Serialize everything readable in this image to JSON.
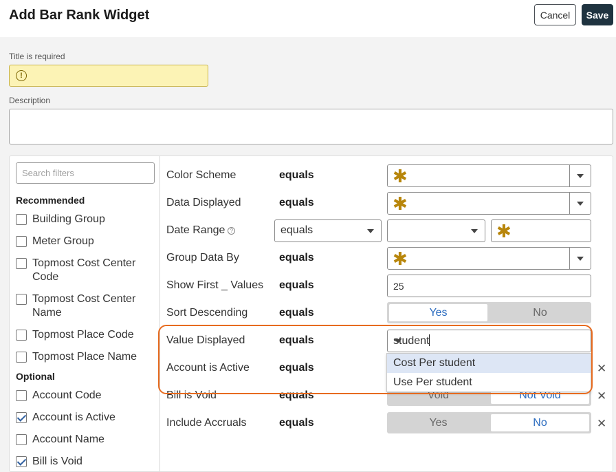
{
  "header": {
    "title": "Add Bar Rank Widget",
    "cancel_label": "Cancel",
    "save_label": "Save"
  },
  "form": {
    "title_label": "Title is required",
    "title_value": "",
    "title_warning_icon": "warning-circle-icon",
    "description_label": "Description",
    "description_value": ""
  },
  "filters": {
    "search_placeholder": "Search filters",
    "recommended_heading": "Recommended",
    "recommended": [
      {
        "label": "Building Group",
        "checked": false
      },
      {
        "label": "Meter Group",
        "checked": false
      },
      {
        "label": "Topmost Cost Center Code",
        "checked": false
      },
      {
        "label": "Topmost Cost Center Name",
        "checked": false
      },
      {
        "label": "Topmost Place Code",
        "checked": false
      },
      {
        "label": "Topmost Place Name",
        "checked": false
      }
    ],
    "optional_heading": "Optional",
    "optional": [
      {
        "label": "Account Code",
        "checked": false
      },
      {
        "label": "Account is Active",
        "checked": true
      },
      {
        "label": "Account Name",
        "checked": false
      },
      {
        "label": "Bill is Void",
        "checked": true
      }
    ]
  },
  "settings": {
    "operator": "equals",
    "rows": [
      {
        "label": "Color Scheme"
      },
      {
        "label": "Data Displayed"
      },
      {
        "label": "Date Range",
        "operator_select": "equals"
      },
      {
        "label": "Group Data By"
      },
      {
        "label": "Show First _ Values",
        "value": "25"
      },
      {
        "label": "Sort Descending",
        "options": [
          "Yes",
          "No"
        ],
        "selected": "Yes"
      },
      {
        "label": "Value Displayed",
        "input": "student"
      },
      {
        "label": "Account is Active"
      },
      {
        "label": "Bill is Void",
        "options": [
          "Void",
          "Not Void"
        ],
        "selected": "Not Void"
      },
      {
        "label": "Include Accruals",
        "options": [
          "Yes",
          "No"
        ],
        "selected": "No"
      }
    ],
    "dropdown": [
      "Cost Per student",
      "Use Per student"
    ],
    "required_marker": "✱",
    "remove_symbol": "✕"
  },
  "colors": {
    "accent": "#2a6bbf",
    "highlight": "#e76b1f",
    "save_button": "#1f3340",
    "required_star": "#b8860b",
    "warning_bg": "#fcf3b5"
  }
}
